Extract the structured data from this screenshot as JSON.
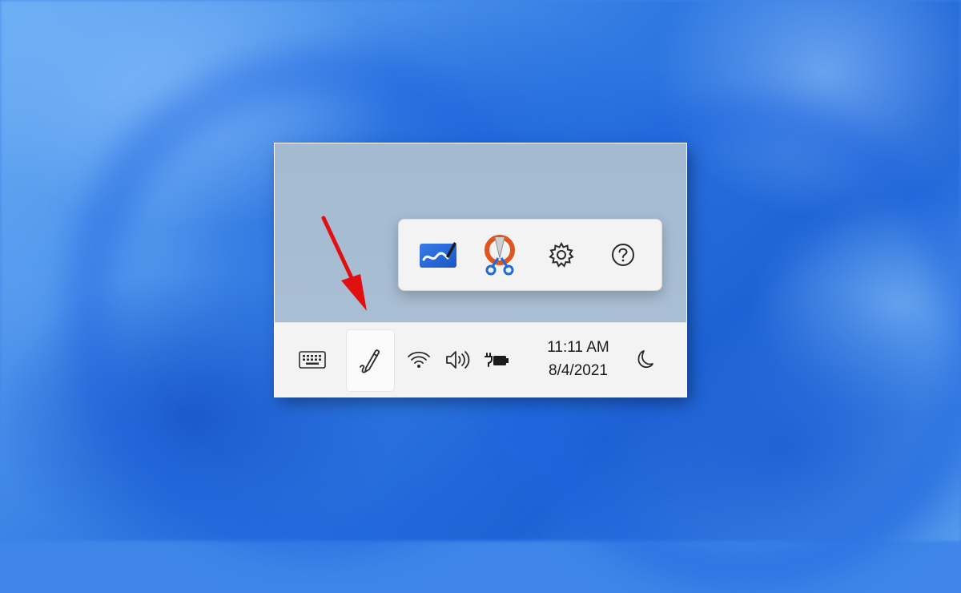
{
  "taskbar": {
    "clock": {
      "time": "11:11 AM",
      "date": "8/4/2021"
    },
    "tray_icons": [
      {
        "name": "touch-keyboard-icon"
      },
      {
        "name": "pen-menu-icon"
      },
      {
        "name": "wifi-icon"
      },
      {
        "name": "volume-icon"
      },
      {
        "name": "battery-charging-icon"
      },
      {
        "name": "focus-assist-moon-icon"
      }
    ]
  },
  "pen_menu": {
    "items": [
      {
        "name": "whiteboard-app-icon"
      },
      {
        "name": "snip-sketch-app-icon"
      },
      {
        "name": "settings-gear-icon"
      },
      {
        "name": "help-icon"
      }
    ]
  },
  "colors": {
    "wallpaper_blue": "#3f86e8",
    "taskbar_bg": "#f3f3f3",
    "annotation_arrow": "#e01010"
  }
}
